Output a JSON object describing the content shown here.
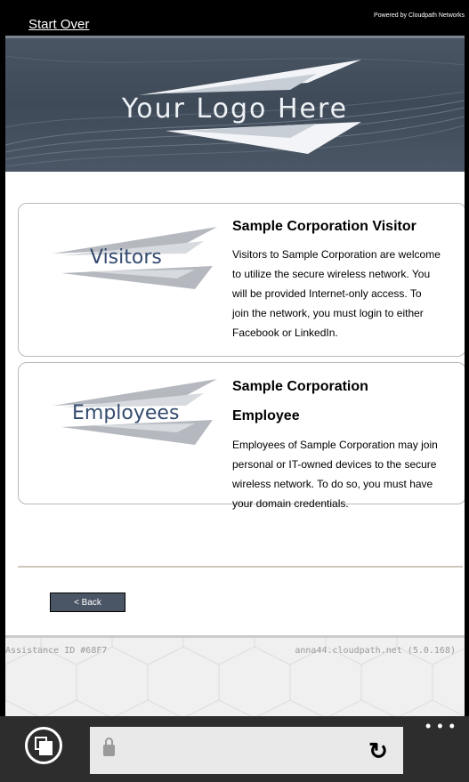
{
  "topbar": {
    "start_over": "Start Over",
    "powered_by": "Powered by Cloudpath Networks"
  },
  "banner": {
    "logo_text": "Your Logo Here"
  },
  "cards": [
    {
      "thumb_label": "Visitors",
      "title": "Sample Corporation Visitor",
      "lines": [
        "Visitors to Sample Corporation are welcome",
        "to utilize the secure wireless network. You",
        "will be provided Internet-only access. To",
        "join the network, you must login to either",
        "Facebook or LinkedIn."
      ]
    },
    {
      "thumb_label": "Employees",
      "title_line1": "Sample Corporation",
      "title_line2": "Employee",
      "lines": [
        "Employees of Sample Corporation may join",
        "personal or IT-owned devices to the secure",
        "wireless network. To do so, you must have",
        "your domain credentials."
      ]
    }
  ],
  "back_button": "< Back",
  "footer": {
    "assistance_id": "Assistance ID #68F7",
    "server": "anna44.cloudpath.net (5.0.168)"
  },
  "browser": {
    "menu_dots": "• • •",
    "refresh_icon": "↻"
  },
  "colors": {
    "banner": "#434e5c",
    "title_text": "#344b6f",
    "browser_bar": "#2d2d2d"
  }
}
